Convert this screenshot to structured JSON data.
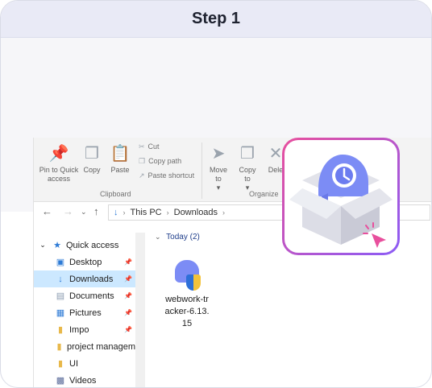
{
  "step": {
    "title": "Step 1"
  },
  "ribbon": {
    "pin_label": "Pin to Quick access",
    "copy_label": "Copy",
    "paste_label": "Paste",
    "cut_label": "Cut",
    "copy_path_label": "Copy path",
    "paste_shortcut_label": "Paste shortcut",
    "clipboard_group": "Clipboard",
    "move_to_label": "Move to",
    "copy_to_label": "Copy to",
    "delete_label": "Dele",
    "organize_group": "Organize"
  },
  "address": {
    "items": [
      "This PC",
      "Downloads"
    ]
  },
  "sidebar": {
    "items": [
      {
        "label": "Quick access",
        "icon": "star-icon"
      },
      {
        "label": "Desktop",
        "icon": "desktop-icon",
        "pinned": true
      },
      {
        "label": "Downloads",
        "icon": "download-arrow-icon",
        "pinned": true,
        "selected": true
      },
      {
        "label": "Documents",
        "icon": "documents-icon",
        "pinned": true
      },
      {
        "label": "Pictures",
        "icon": "pictures-icon",
        "pinned": true
      },
      {
        "label": "Impo",
        "icon": "folder-icon",
        "pinned": true
      },
      {
        "label": "project managem",
        "icon": "folder-icon"
      },
      {
        "label": "UI",
        "icon": "folder-icon"
      },
      {
        "label": "Videos",
        "icon": "videos-icon"
      }
    ]
  },
  "content": {
    "group_label": "Today (2)",
    "file": {
      "name_line1": "webwork-tr",
      "name_line2": "acker-6.13.",
      "name_line3": "15"
    }
  },
  "colors": {
    "accent": "#2e7bd6",
    "selection": "#cce8ff",
    "card_gradient_start": "#e84f9d",
    "card_gradient_end": "#8b5cf6",
    "brand": "#7c8cf5"
  }
}
